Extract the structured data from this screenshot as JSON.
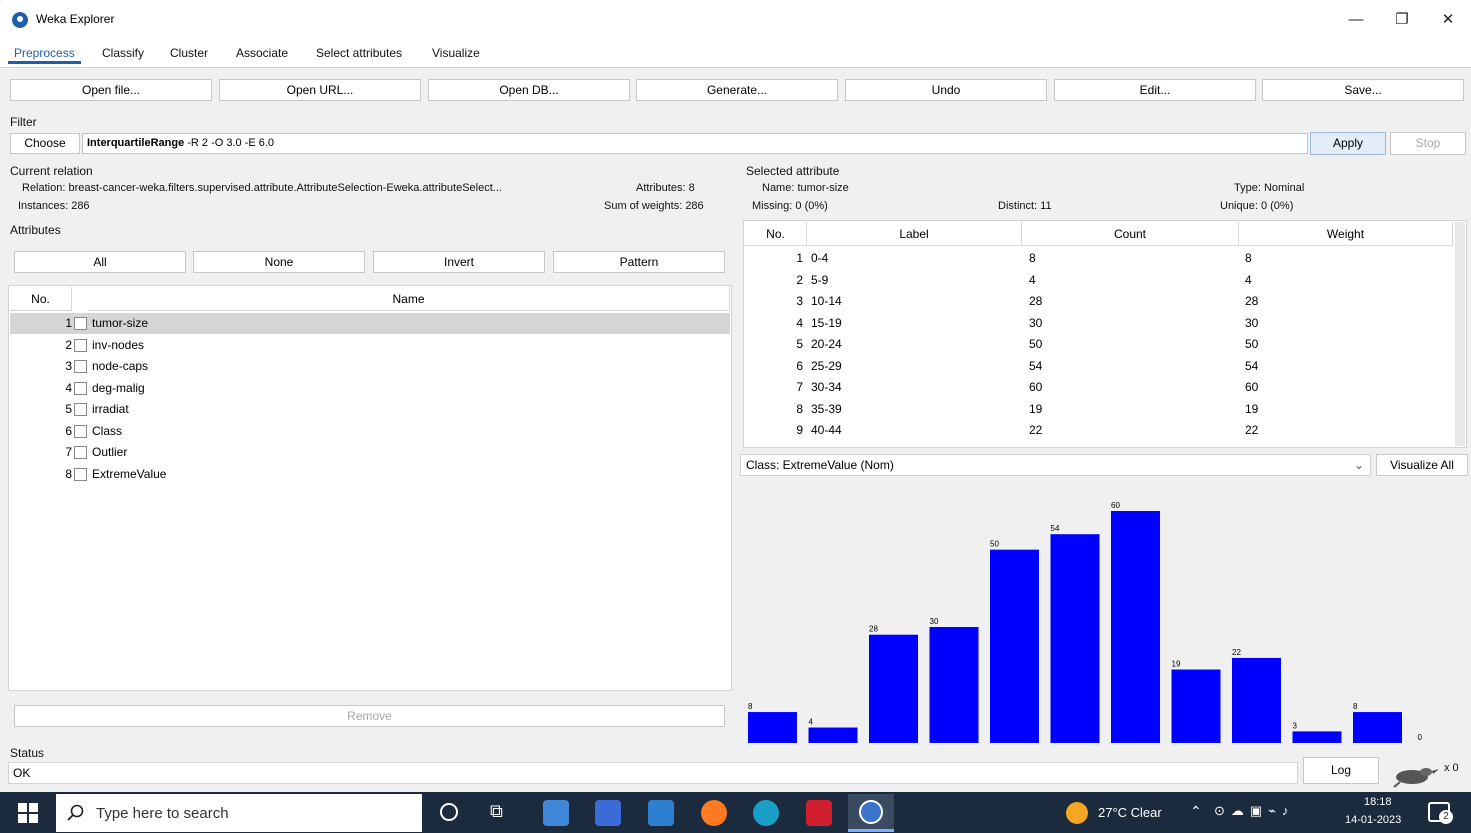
{
  "window": {
    "title": "Weka Explorer",
    "minimize": "—",
    "restore": "❐",
    "close": "✕"
  },
  "tabs": [
    "Preprocess",
    "Classify",
    "Cluster",
    "Associate",
    "Select attributes",
    "Visualize"
  ],
  "toolbar": [
    "Open file...",
    "Open URL...",
    "Open DB...",
    "Generate...",
    "Undo",
    "Edit...",
    "Save..."
  ],
  "filter": {
    "section_label": "Filter",
    "choose_label": "Choose",
    "name": "InterquartileRange",
    "options": " -R 2 -O 3.0 -E 6.0",
    "apply_label": "Apply",
    "stop_label": "Stop"
  },
  "current_relation": {
    "section_label": "Current relation",
    "relation": "Relation: breast-cancer-weka.filters.supervised.attribute.AttributeSelection-Eweka.attributeSelect...",
    "instances": "Instances: 286",
    "attributes": "Attributes: 8",
    "sum_of_weights": "Sum of weights: 286"
  },
  "attributes": {
    "section_label": "Attributes",
    "buttons": [
      "All",
      "None",
      "Invert",
      "Pattern"
    ],
    "col_no": "No.",
    "col_name": "Name",
    "rows": [
      {
        "no": "1",
        "name": "tumor-size"
      },
      {
        "no": "2",
        "name": "inv-nodes"
      },
      {
        "no": "3",
        "name": "node-caps"
      },
      {
        "no": "4",
        "name": "deg-malig"
      },
      {
        "no": "5",
        "name": "irradiat"
      },
      {
        "no": "6",
        "name": "Class"
      },
      {
        "no": "7",
        "name": "Outlier"
      },
      {
        "no": "8",
        "name": "ExtremeValue"
      }
    ],
    "remove_label": "Remove"
  },
  "selected_attribute": {
    "section_label": "Selected attribute",
    "name": "Name: tumor-size",
    "type": "Type: Nominal",
    "missing": "Missing: 0 (0%)",
    "distinct": "Distinct: 11",
    "unique": "Unique: 0 (0%)",
    "columns": [
      "No.",
      "Label",
      "Count",
      "Weight"
    ],
    "rows": [
      {
        "no": "1",
        "label": "0-4",
        "count": "8",
        "weight": "8"
      },
      {
        "no": "2",
        "label": "5-9",
        "count": "4",
        "weight": "4"
      },
      {
        "no": "3",
        "label": "10-14",
        "count": "28",
        "weight": "28"
      },
      {
        "no": "4",
        "label": "15-19",
        "count": "30",
        "weight": "30"
      },
      {
        "no": "5",
        "label": "20-24",
        "count": "50",
        "weight": "50"
      },
      {
        "no": "6",
        "label": "25-29",
        "count": "54",
        "weight": "54"
      },
      {
        "no": "7",
        "label": "30-34",
        "count": "60",
        "weight": "60"
      },
      {
        "no": "8",
        "label": "35-39",
        "count": "19",
        "weight": "19"
      },
      {
        "no": "9",
        "label": "40-44",
        "count": "22",
        "weight": "22"
      }
    ]
  },
  "class_selector": {
    "value": "Class: ExtremeValue (Nom)",
    "visualize_all": "Visualize All"
  },
  "chart_data": {
    "type": "bar",
    "values": [
      8,
      4,
      28,
      30,
      50,
      54,
      60,
      19,
      22,
      3,
      8,
      0
    ],
    "data_labels": [
      "8",
      "4",
      "28",
      "30",
      "50",
      "54",
      "60",
      "19",
      "22",
      "3",
      "8",
      "0"
    ],
    "bar_color": "#0000ff",
    "ylim": [
      0,
      60
    ]
  },
  "status": {
    "section_label": "Status",
    "text": "OK",
    "log_label": "Log",
    "count": "x 0"
  },
  "taskbar": {
    "search_placeholder": "Type here to search",
    "weather": "27°C Clear",
    "time": "18:18",
    "date": "14-01-2023",
    "notifications": "2"
  }
}
